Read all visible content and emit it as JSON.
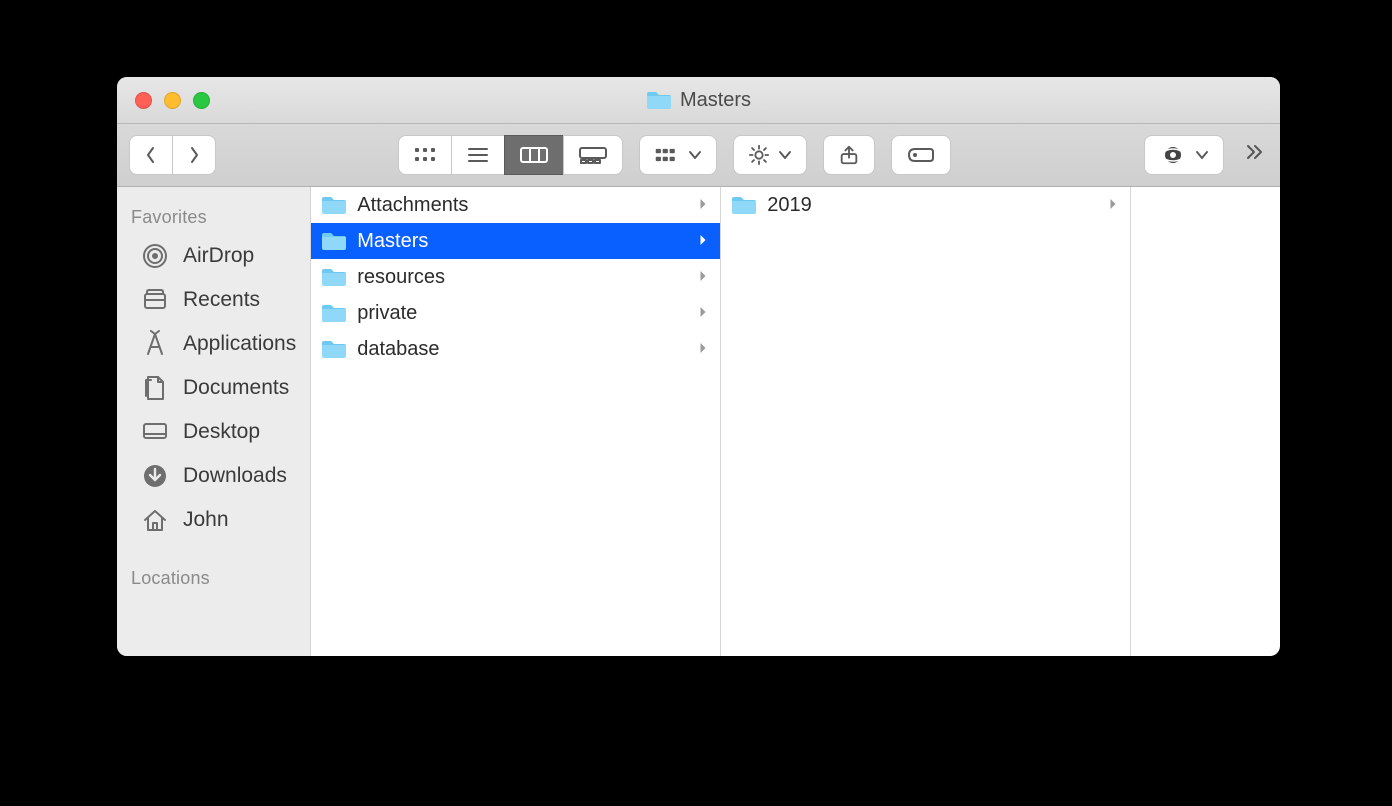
{
  "titlebar": {
    "title": "Masters"
  },
  "sidebar": {
    "sections": [
      {
        "heading": "Favorites",
        "items": [
          {
            "name": "airdrop",
            "label": "AirDrop",
            "icon": "airdrop-icon"
          },
          {
            "name": "recents",
            "label": "Recents",
            "icon": "recents-icon"
          },
          {
            "name": "applications",
            "label": "Applications",
            "icon": "applications-icon"
          },
          {
            "name": "documents",
            "label": "Documents",
            "icon": "documents-icon"
          },
          {
            "name": "desktop",
            "label": "Desktop",
            "icon": "desktop-icon"
          },
          {
            "name": "downloads",
            "label": "Downloads",
            "icon": "downloads-icon"
          },
          {
            "name": "home",
            "label": "John",
            "icon": "home-icon"
          }
        ]
      },
      {
        "heading": "Locations",
        "items": []
      }
    ]
  },
  "columns": [
    {
      "items": [
        {
          "label": "Attachments",
          "expandable": true,
          "selected": false
        },
        {
          "label": "Masters",
          "expandable": true,
          "selected": true
        },
        {
          "label": "resources",
          "expandable": true,
          "selected": false
        },
        {
          "label": "private",
          "expandable": true,
          "selected": false
        },
        {
          "label": "database",
          "expandable": true,
          "selected": false
        }
      ]
    },
    {
      "items": [
        {
          "label": "2019",
          "expandable": true,
          "selected": false
        }
      ]
    }
  ]
}
